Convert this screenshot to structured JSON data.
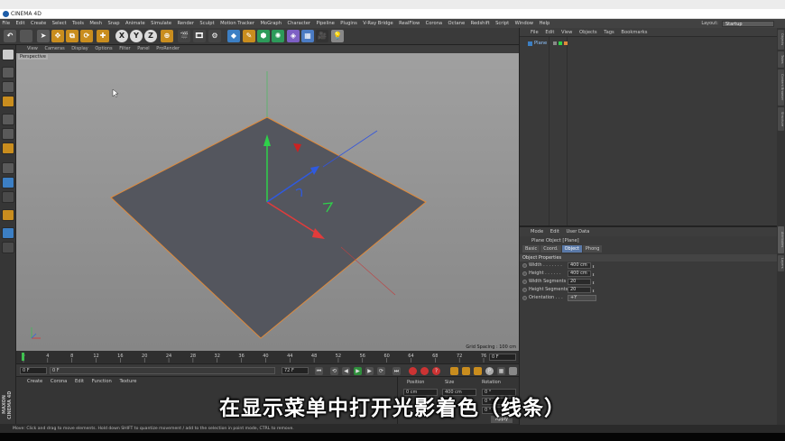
{
  "app": {
    "title": "CINEMA 4D"
  },
  "menu": [
    "File",
    "Edit",
    "Create",
    "Select",
    "Tools",
    "Mesh",
    "Snap",
    "Animate",
    "Simulate",
    "Render",
    "Sculpt",
    "Motion Tracker",
    "MoGraph",
    "Character",
    "Pipeline",
    "Plugins",
    "V-Ray Bridge",
    "RealFlow",
    "Corona",
    "Octane",
    "Redshift",
    "Script",
    "Window",
    "Help"
  ],
  "layout": {
    "label": "Layout:",
    "value": "Startup"
  },
  "toolbar": {
    "axis_labels": [
      "X",
      "Y",
      "Z"
    ]
  },
  "viewport": {
    "menu": [
      "View",
      "Cameras",
      "Display",
      "Options",
      "Filter",
      "Panel",
      "ProRender"
    ],
    "label": "Perspective",
    "grid_spacing": "Grid Spacing : 100 cm"
  },
  "timeline": {
    "ticks": [
      "0",
      "4",
      "8",
      "12",
      "16",
      "20",
      "24",
      "28",
      "32",
      "36",
      "40",
      "44",
      "48",
      "52",
      "56",
      "60",
      "64",
      "68",
      "72",
      "76"
    ],
    "current_frame": "0 F",
    "start_frame": "0 F",
    "min_frame": "0 F",
    "end_frame": "72 F",
    "max_frame": "72 F"
  },
  "material_manager": {
    "menu": [
      "Create",
      "Corona",
      "Edit",
      "Function",
      "Texture"
    ]
  },
  "coordinates": {
    "headers": [
      "Position",
      "Size",
      "Rotation"
    ],
    "row1": [
      "0 cm",
      "400 cm",
      "0 °"
    ],
    "row2": [
      "",
      "",
      "0 °"
    ],
    "row3": [
      "",
      "",
      "0 °"
    ],
    "apply": "Apply"
  },
  "object_manager": {
    "menu": [
      "File",
      "Edit",
      "View",
      "Objects",
      "Tags",
      "Bookmarks"
    ],
    "objects": [
      {
        "name": "Plane"
      }
    ]
  },
  "attribute_manager": {
    "menu": [
      "Mode",
      "Edit",
      "User Data"
    ],
    "title": "Plane Object [Plane]",
    "tabs": [
      "Basic",
      "Coord.",
      "Object",
      "Phong"
    ],
    "active_tab": "Object",
    "section": "Object Properties",
    "properties": [
      {
        "label": "Width . . . . . . .",
        "value": "400 cm"
      },
      {
        "label": "Height . . . . . .",
        "value": "400 cm"
      },
      {
        "label": "Width Segments",
        "value": "20"
      },
      {
        "label": "Height Segments",
        "value": "20"
      },
      {
        "label": "Orientation . . .",
        "value": "+Y"
      }
    ]
  },
  "right_tabs": [
    "Objects",
    "Takes",
    "Content Browser",
    "Structure",
    "Attributes",
    "Layers"
  ],
  "status": "Move: Click and drag to move elements. Hold down SHIFT to quantize movement / add to the selection in point mode, CTRL to remove.",
  "brand": "MAXON CINEMA 4D",
  "subtitle": "在显示菜单中打开光影着色（线条）",
  "colors": {
    "selection_orange": "#e08a3a",
    "axis_x": "#e23b3b",
    "axis_y": "#2fd14a",
    "axis_z": "#2f5ae0",
    "active_tab": "#5a79a8"
  }
}
